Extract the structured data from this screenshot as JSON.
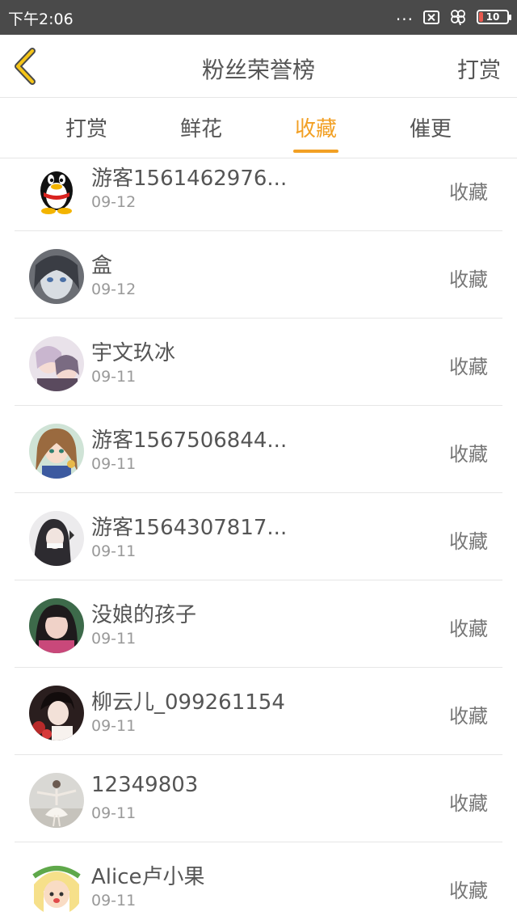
{
  "status_bar": {
    "time": "下午2:06",
    "dots": "...",
    "battery": "10"
  },
  "header": {
    "back_icon": "chevron-left-icon",
    "title": "粉丝荣誉榜",
    "right_action": "打赏"
  },
  "tabs": [
    {
      "label": "打赏",
      "active": false
    },
    {
      "label": "鲜花",
      "active": false
    },
    {
      "label": "收藏",
      "active": true
    },
    {
      "label": "催更",
      "active": false
    }
  ],
  "colors": {
    "accent": "#f2a024",
    "status_bar": "#4a4a4a",
    "text": "#555555",
    "date_text": "#999999",
    "divider": "#e6e6e6"
  },
  "items": [
    {
      "name": "游客1561462976...",
      "date": "09-12",
      "action": "收藏",
      "avatar": "qq-penguin-avatar"
    },
    {
      "name": "盒",
      "date": "09-12",
      "action": "收藏",
      "avatar": "anime-girl-avatar"
    },
    {
      "name": "宇文玖冰",
      "date": "09-11",
      "action": "收藏",
      "avatar": "anime-girl-avatar"
    },
    {
      "name": "游客1567506844...",
      "date": "09-11",
      "action": "收藏",
      "avatar": "anime-girl-avatar"
    },
    {
      "name": "游客1564307817...",
      "date": "09-11",
      "action": "收藏",
      "avatar": "photo-girl-avatar"
    },
    {
      "name": "没娘的孩子",
      "date": "09-11",
      "action": "收藏",
      "avatar": "photo-girl-avatar"
    },
    {
      "name": "柳云儿_099261154",
      "date": "09-11",
      "action": "收藏",
      "avatar": "photo-boy-avatar"
    },
    {
      "name": "12349803",
      "date": "09-11",
      "action": "收藏",
      "avatar": "ballerina-avatar"
    },
    {
      "name": "Alice卢小果",
      "date": "09-11",
      "action": "收藏",
      "avatar": "cartoon-girl-avatar"
    }
  ]
}
